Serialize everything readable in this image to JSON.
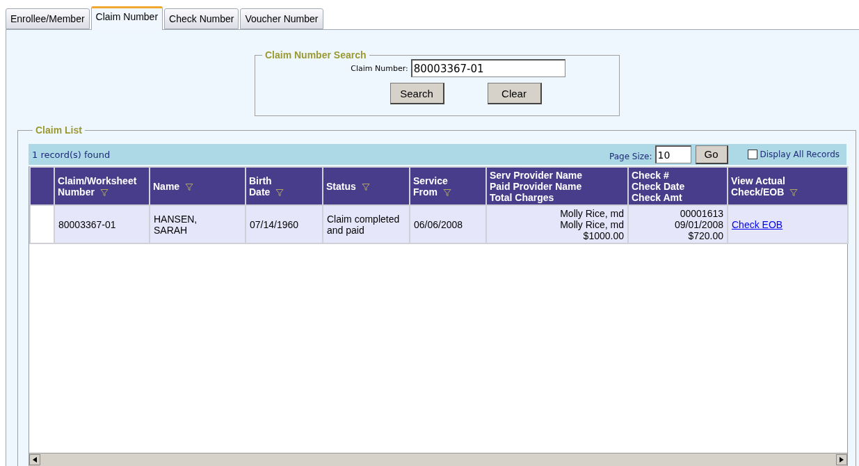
{
  "tabs": [
    {
      "label": "Enrollee/Member",
      "selected": false
    },
    {
      "label": "Claim Number",
      "selected": true
    },
    {
      "label": "Check Number",
      "selected": false
    },
    {
      "label": "Voucher Number",
      "selected": false
    }
  ],
  "search": {
    "title": "Claim Number Search",
    "field_label": "Claim Number:",
    "value": "80003367-01",
    "buttons": [
      "Search",
      "Clear"
    ]
  },
  "claim_list": {
    "title": "Claim List",
    "record_count": "1 record(s) found",
    "page_size_label": "Page Size:",
    "page_size": "10",
    "go_button": "Go",
    "display_all": {
      "label": "Display All Records",
      "checked": false
    },
    "columns": [
      {
        "label": "Claim/Worksheet\nNumber",
        "filter": true
      },
      {
        "label": "Name",
        "filter": true
      },
      {
        "label": "Birth\nDate",
        "filter": true
      },
      {
        "label": "Status",
        "filter": true
      },
      {
        "label": "Service\nFrom",
        "filter": true
      },
      {
        "label": "Serv Provider Name\nPaid Provider Name\nTotal Charges",
        "filter": false
      },
      {
        "label": "Check #\nCheck Date\nCheck Amt",
        "filter": false
      },
      {
        "label": "View Actual\nCheck/EOB",
        "filter": true
      }
    ],
    "rows": [
      {
        "cells": [
          "80003367-01",
          "HANSEN,\nSARAH",
          "07/14/1960",
          "Claim completed\nand paid",
          "06/06/2008",
          "Molly Rice, md\nMolly Rice, md\n$1000.00",
          "00001613\n09/01/2008\n$720.00"
        ],
        "link": "Check EOB"
      }
    ]
  }
}
